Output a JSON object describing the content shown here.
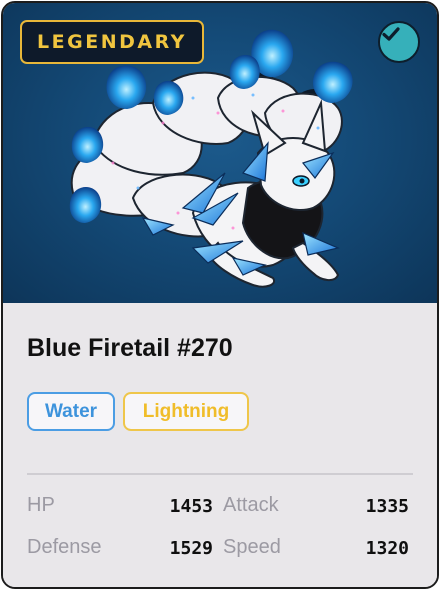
{
  "card": {
    "rarity": "LEGENDARY",
    "verified_icon": "check-icon",
    "name": "Blue Firetail #270",
    "types": [
      "Water",
      "Lightning"
    ],
    "stats": {
      "hp_label": "HP",
      "hp_value": "1453",
      "attack_label": "Attack",
      "attack_value": "1335",
      "defense_label": "Defense",
      "defense_value": "1529",
      "speed_label": "Speed",
      "speed_value": "1320"
    }
  },
  "colors": {
    "rarity_gold": "#f0c53f",
    "art_background": "#144a77",
    "verified_teal": "#36b0ba",
    "water_blue": "#3d93dc",
    "lightning_yellow": "#f0bd2a",
    "flame_blue": "#2aa8f0"
  }
}
